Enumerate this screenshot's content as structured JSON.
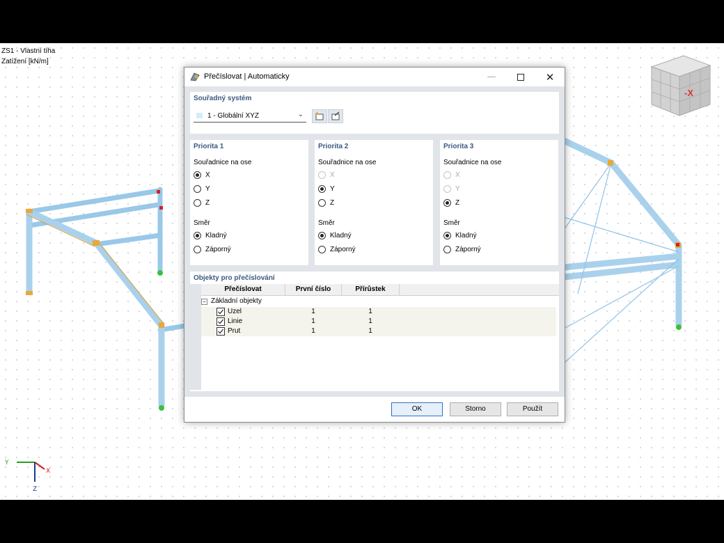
{
  "viewport": {
    "info_line1": "ZS1 - Vlastní tíha",
    "info_line2": "Zatížení [kN/m]",
    "viewcube_face": "-X",
    "axes": {
      "y": "Y",
      "x": "X",
      "z": "Z"
    }
  },
  "dialog": {
    "title": "Přečíslovat | Automaticky",
    "coord_system": {
      "title": "Souřadný systém",
      "selected": "1 - Globální XYZ"
    },
    "priorities": [
      {
        "title": "Priorita 1",
        "axis_label": "Souřadnice na ose",
        "axes": [
          "X",
          "Y",
          "Z"
        ],
        "axis_selected": "X",
        "axis_disabled": [],
        "dir_label": "Směr",
        "dirs": [
          "Kladný",
          "Záporný"
        ],
        "dir_selected": "Kladný"
      },
      {
        "title": "Priorita 2",
        "axis_label": "Souřadnice na ose",
        "axes": [
          "X",
          "Y",
          "Z"
        ],
        "axis_selected": "Y",
        "axis_disabled": [
          "X"
        ],
        "dir_label": "Směr",
        "dirs": [
          "Kladný",
          "Záporný"
        ],
        "dir_selected": "Kladný"
      },
      {
        "title": "Priorita 3",
        "axis_label": "Souřadnice na ose",
        "axes": [
          "X",
          "Y",
          "Z"
        ],
        "axis_selected": "Z",
        "axis_disabled": [
          "X",
          "Y"
        ],
        "dir_label": "Směr",
        "dirs": [
          "Kladný",
          "Záporný"
        ],
        "dir_selected": "Kladný"
      }
    ],
    "objects": {
      "title": "Objekty pro přečíslování",
      "columns": [
        "Přečíslovat",
        "První číslo",
        "Přírůstek"
      ],
      "group": "Základní objekty",
      "rows": [
        {
          "name": "Uzel",
          "checked": true,
          "first": "1",
          "step": "1"
        },
        {
          "name": "Linie",
          "checked": true,
          "first": "1",
          "step": "1"
        },
        {
          "name": "Prut",
          "checked": true,
          "first": "1",
          "step": "1"
        }
      ]
    },
    "buttons": {
      "ok": "OK",
      "cancel": "Storno",
      "apply": "Použít"
    }
  }
}
